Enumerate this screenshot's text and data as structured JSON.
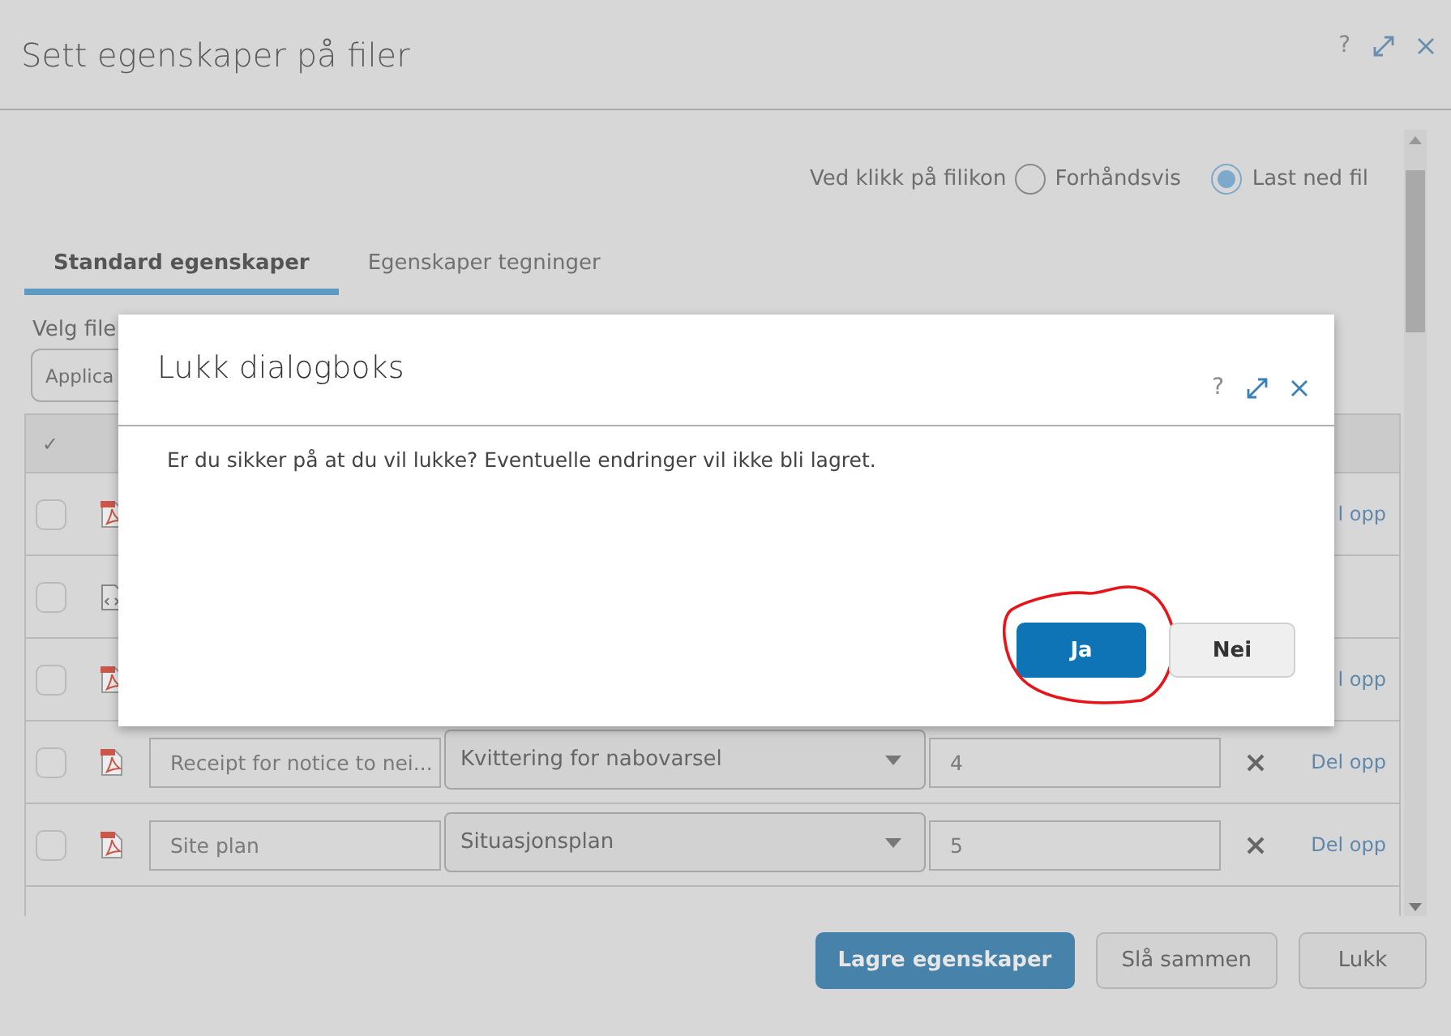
{
  "window": {
    "title": "Sett egenskaper på filer",
    "controls": [
      "?"
    ]
  },
  "file_click": {
    "label": "Ved klikk på filikon",
    "options": [
      {
        "label": "Forhåndsvis",
        "selected": false
      },
      {
        "label": "Last ned fil",
        "selected": true
      }
    ]
  },
  "tabs": [
    {
      "label": "Standard egenskaper",
      "selected": true
    },
    {
      "label": "Egenskaper tegninger",
      "selected": false
    }
  ],
  "file_select": {
    "label": "Velg file",
    "value": "Applica"
  },
  "table": {
    "header_check": "✓",
    "rows": [
      {
        "checked": false,
        "kind": "pdf",
        "action": "l opp"
      },
      {
        "checked": false,
        "kind": "code"
      },
      {
        "checked": false,
        "kind": "pdf",
        "action": "l opp"
      },
      {
        "checked": false,
        "kind": "pdf",
        "name": "Receipt for notice to nei...",
        "type": "Kvittering for nabovarsel",
        "number": "4",
        "removable": true,
        "action": "Del opp"
      },
      {
        "checked": false,
        "kind": "pdf",
        "name": "Site plan",
        "type": "Situasjonsplan",
        "number": "5",
        "removable": true,
        "action": "Del opp"
      }
    ]
  },
  "footer_buttons": [
    {
      "label": "Lagre egenskaper",
      "kind": "primary"
    },
    {
      "label": "Slå sammen",
      "kind": "secondary"
    },
    {
      "label": "Lukk",
      "kind": "secondary"
    }
  ],
  "dialog": {
    "title": "Lukk dialogboks",
    "help": "?",
    "message": "Er du sikker på at du vil lukke? Eventuelle endringer vil ikke bli lagret.",
    "buttons": [
      {
        "label": "Ja",
        "kind": "primary",
        "highlighted": true
      },
      {
        "label": "Nei",
        "kind": "secondary"
      }
    ]
  }
}
